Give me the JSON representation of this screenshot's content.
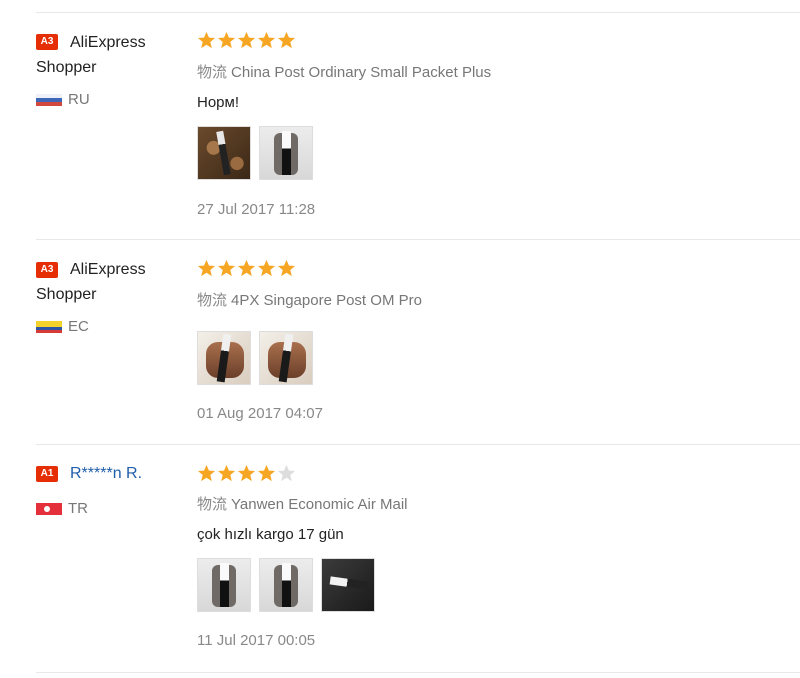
{
  "colors": {
    "star_on": "#f6a623",
    "star_off": "#dddddd",
    "badge": "#e62e04",
    "link": "#1f5ea8"
  },
  "reviews": [
    {
      "badge": "A3",
      "name_line1": "AliExpress",
      "name_line2": "Shopper",
      "country": "RU",
      "flag": "flag-ru",
      "rating": 5,
      "shipping_cn": "物流",
      "shipping": "China Post Ordinary Small Packet Plus",
      "comment": "Норм!",
      "photos": [
        "p-wood",
        "p-knife"
      ],
      "date": "27 Jul 2017 11:28"
    },
    {
      "badge": "A3",
      "name_line1": "AliExpress",
      "name_line2": "Shopper",
      "country": "EC",
      "flag": "flag-ec",
      "rating": 5,
      "shipping_cn": "物流",
      "shipping": "4PX Singapore Post OM Pro",
      "comment": "",
      "photos": [
        "p-hand",
        "p-hand"
      ],
      "date": "01 Aug 2017 04:07"
    },
    {
      "badge": "A1",
      "name_line1": "R*****n R.",
      "name_line2": "",
      "country": "TR",
      "flag": "flag-tr",
      "rating": 4,
      "shipping_cn": "物流",
      "shipping": "Yanwen Economic Air Mail",
      "comment": "çok hızlı kargo 17 gün",
      "photos": [
        "p-knife",
        "p-knife",
        "p-dark"
      ],
      "date": "11 Jul 2017 00:05"
    }
  ]
}
